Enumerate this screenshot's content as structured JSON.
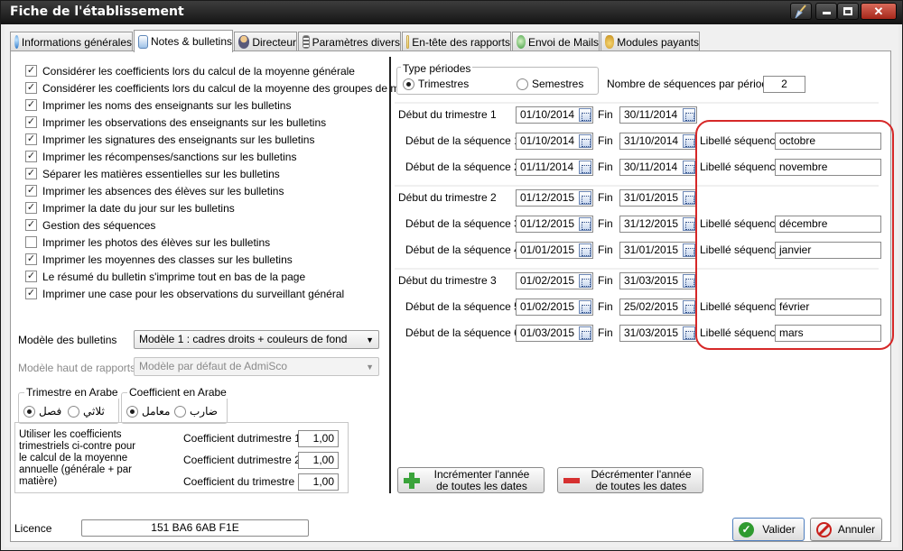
{
  "window": {
    "title": "Fiche de l'établissement",
    "controls": [
      "broom",
      "minimize",
      "maximize",
      "close"
    ]
  },
  "tabs": [
    {
      "label": "Informations générales",
      "icon": "globe-icon",
      "active": false
    },
    {
      "label": "Notes & bulletins",
      "icon": "notes-icon",
      "active": true
    },
    {
      "label": "Directeur",
      "icon": "person-icon",
      "active": false
    },
    {
      "label": "Paramètres divers",
      "icon": "list-icon",
      "active": false
    },
    {
      "label": "En-tête des rapports",
      "icon": "document-icon",
      "active": false
    },
    {
      "label": "Envoi de Mails",
      "icon": "mail-icon",
      "active": false
    },
    {
      "label": "Modules payants",
      "icon": "money-bag-icon",
      "active": false
    }
  ],
  "options": [
    {
      "label": "Considérer les coefficients lors du calcul de la moyenne générale",
      "checked": true
    },
    {
      "label": "Considérer les coefficients lors du calcul de la moyenne des groupes de matières",
      "checked": true
    },
    {
      "label": "Imprimer les noms des enseignants sur les bulletins",
      "checked": true
    },
    {
      "label": "Imprimer les observations des enseignants sur les bulletins",
      "checked": true
    },
    {
      "label": "Imprimer les signatures des enseignants sur les bulletins",
      "checked": true
    },
    {
      "label": "Imprimer les récompenses/sanctions sur les bulletins",
      "checked": true
    },
    {
      "label": "Séparer les matières essentielles sur les bulletins",
      "checked": true
    },
    {
      "label": "Imprimer les absences des élèves sur les bulletins",
      "checked": true
    },
    {
      "label": "Imprimer la date du jour sur les bulletins",
      "checked": true
    },
    {
      "label": "Gestion des séquences",
      "checked": true
    },
    {
      "label": "Imprimer les photos des élèves sur les bulletins",
      "checked": false
    },
    {
      "label": "Imprimer les moyennes des classes sur les bulletins",
      "checked": true
    },
    {
      "label": "Le résumé du bulletin s'imprime tout en bas de la page",
      "checked": true
    },
    {
      "label": "Imprimer une case pour les observations du surveillant général",
      "checked": true
    }
  ],
  "modele_bulletins": {
    "label": "Modèle des bulletins",
    "value": "Modèle 1 : cadres droits + couleurs de fond"
  },
  "modele_rapports": {
    "label": "Modèle haut de rapports",
    "value": "Modèle par défaut de AdmiSco"
  },
  "trimestre_arabe": {
    "title": "Trimestre en Arabe",
    "option_1": "فصل",
    "option_2": "ثلاثي",
    "selected": 1
  },
  "coefficient_arabe": {
    "title": "Coefficient en Arabe",
    "option_1": "معامل",
    "option_2": "ضارب",
    "selected": 1
  },
  "coefficients": {
    "description": "Utiliser les coefficients trimestriels ci-contre pour le calcul de la moyenne annuelle (générale + par matière)",
    "items": [
      {
        "label": "Coefficient dutrimestre 1",
        "value": "1,00"
      },
      {
        "label": "Coefficient dutrimestre 2",
        "value": "1,00"
      },
      {
        "label": "Coefficient du trimestre 3",
        "value": "1,00"
      }
    ]
  },
  "type_periodes": {
    "title": "Type périodes",
    "option_1": "Trimestres",
    "option_2": "Semestres",
    "selected": 1
  },
  "nb_sequences": {
    "label": "Nombre de séquences par période",
    "value": "2"
  },
  "fin_label": "Fin",
  "libelle_label": "Libellé séquence",
  "periods": [
    {
      "label": "Début du trimestre 1",
      "start": "01/10/2014",
      "end": "30/11/2014",
      "sequences": [
        {
          "label": "Début de la séquence 1",
          "start": "01/10/2014",
          "end": "31/10/2014",
          "libelle": "octobre"
        },
        {
          "label": "Début de la séquence 2",
          "start": "01/11/2014",
          "end": "30/11/2014",
          "libelle": "novembre"
        }
      ]
    },
    {
      "label": "Début du trimestre 2",
      "start": "01/12/2015",
      "end": "31/01/2015",
      "sequences": [
        {
          "label": "Début de la séquence 3",
          "start": "01/12/2015",
          "end": "31/12/2015",
          "libelle": "décembre"
        },
        {
          "label": "Début de la séquence 4",
          "start": "01/01/2015",
          "end": "31/01/2015",
          "libelle": "janvier"
        }
      ]
    },
    {
      "label": "Début du trimestre 3",
      "start": "01/02/2015",
      "end": "31/03/2015",
      "sequences": [
        {
          "label": "Début de la séquence 5",
          "start": "01/02/2015",
          "end": "25/02/2015",
          "libelle": "février"
        },
        {
          "label": "Début de la séquence 6",
          "start": "01/03/2015",
          "end": "31/03/2015",
          "libelle": "mars"
        }
      ]
    }
  ],
  "increment_button": {
    "line1": "Incrémenter l'année",
    "line2": "de toutes les dates"
  },
  "decrement_button": {
    "line1": "Décrémenter l'année",
    "line2": "de toutes les dates"
  },
  "licence": {
    "label": "Licence",
    "value": "151 BA6 6AB F1E"
  },
  "valider_label": "Valider",
  "annuler_label": "Annuler",
  "colors": {
    "check_green": "#2f9a2f",
    "cancel_red": "#c9201c",
    "highlight_red": "#d62828"
  }
}
